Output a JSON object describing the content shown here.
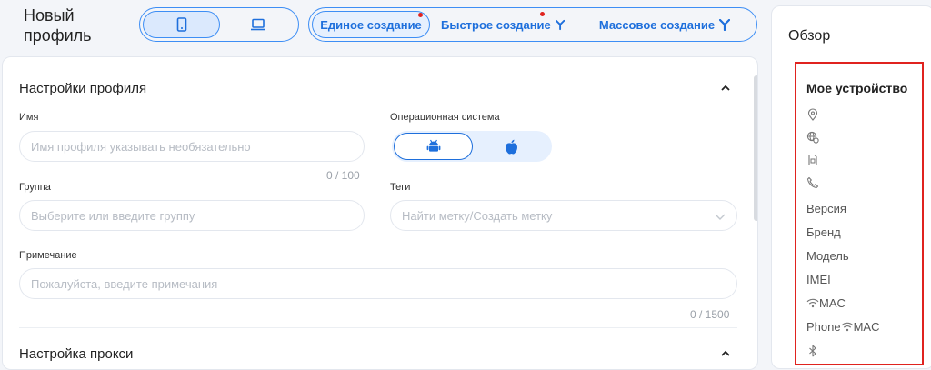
{
  "page": {
    "title": "Новый профиль"
  },
  "device_toggle": {
    "items": [
      {
        "icon": "phone-icon",
        "active": true
      },
      {
        "icon": "laptop-icon",
        "active": false
      }
    ]
  },
  "mode_tabs": [
    {
      "label": "Единое создание",
      "active": true,
      "badge": true
    },
    {
      "label": "Быстрое создание",
      "active": false,
      "badge": true,
      "icon": "quick-create-icon"
    },
    {
      "label": "Массовое создание",
      "active": false,
      "badge": false,
      "icon": "bulk-create-icon"
    }
  ],
  "profile_settings": {
    "title": "Настройки профиля",
    "name": {
      "label": "Имя",
      "placeholder": "Имя профиля указывать необязательно",
      "counter": "0 / 100"
    },
    "os": {
      "label": "Операционная система",
      "options": [
        {
          "icon": "android-icon",
          "active": true
        },
        {
          "icon": "apple-icon",
          "active": false
        }
      ]
    },
    "group": {
      "label": "Группа",
      "placeholder": "Выберите или введите группу"
    },
    "tags": {
      "label": "Теги",
      "placeholder": "Найти метку/Создать метку"
    },
    "note": {
      "label": "Примечание",
      "placeholder": "Пожалуйста, введите примечания",
      "counter": "0 / 1500"
    }
  },
  "proxy_settings": {
    "title": "Настройка прокси"
  },
  "overview": {
    "title": "Обзор",
    "device_heading": "Мое устройство",
    "icon_rows": [
      "location-icon",
      "network-icon",
      "sim-icon",
      "phone-call-icon"
    ],
    "text_rows": [
      "Версия",
      "Бренд",
      "Модель",
      "IMEI"
    ],
    "wifi_mac_label": "MAC",
    "phone_wifi_mac": {
      "prefix": "Phone",
      "suffix": "MAC"
    },
    "bluetooth_icon": "bluetooth-icon"
  },
  "colors": {
    "accent": "#1e6fdc",
    "highlight": "#e0231f"
  }
}
